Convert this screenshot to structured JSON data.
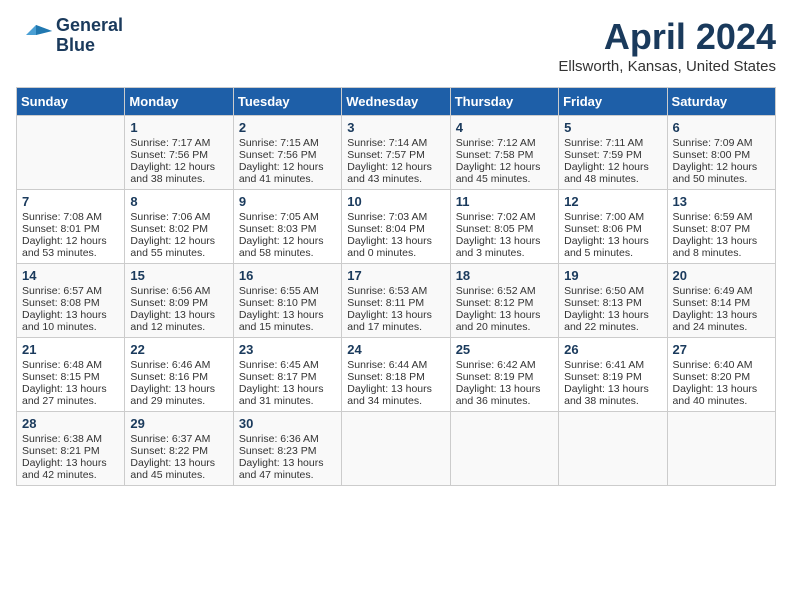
{
  "header": {
    "logo_line1": "General",
    "logo_line2": "Blue",
    "month": "April 2024",
    "location": "Ellsworth, Kansas, United States"
  },
  "weekdays": [
    "Sunday",
    "Monday",
    "Tuesday",
    "Wednesday",
    "Thursday",
    "Friday",
    "Saturday"
  ],
  "weeks": [
    [
      {
        "day": "",
        "sunrise": "",
        "sunset": "",
        "daylight": ""
      },
      {
        "day": "1",
        "sunrise": "Sunrise: 7:17 AM",
        "sunset": "Sunset: 7:56 PM",
        "daylight": "Daylight: 12 hours and 38 minutes."
      },
      {
        "day": "2",
        "sunrise": "Sunrise: 7:15 AM",
        "sunset": "Sunset: 7:56 PM",
        "daylight": "Daylight: 12 hours and 41 minutes."
      },
      {
        "day": "3",
        "sunrise": "Sunrise: 7:14 AM",
        "sunset": "Sunset: 7:57 PM",
        "daylight": "Daylight: 12 hours and 43 minutes."
      },
      {
        "day": "4",
        "sunrise": "Sunrise: 7:12 AM",
        "sunset": "Sunset: 7:58 PM",
        "daylight": "Daylight: 12 hours and 45 minutes."
      },
      {
        "day": "5",
        "sunrise": "Sunrise: 7:11 AM",
        "sunset": "Sunset: 7:59 PM",
        "daylight": "Daylight: 12 hours and 48 minutes."
      },
      {
        "day": "6",
        "sunrise": "Sunrise: 7:09 AM",
        "sunset": "Sunset: 8:00 PM",
        "daylight": "Daylight: 12 hours and 50 minutes."
      }
    ],
    [
      {
        "day": "7",
        "sunrise": "Sunrise: 7:08 AM",
        "sunset": "Sunset: 8:01 PM",
        "daylight": "Daylight: 12 hours and 53 minutes."
      },
      {
        "day": "8",
        "sunrise": "Sunrise: 7:06 AM",
        "sunset": "Sunset: 8:02 PM",
        "daylight": "Daylight: 12 hours and 55 minutes."
      },
      {
        "day": "9",
        "sunrise": "Sunrise: 7:05 AM",
        "sunset": "Sunset: 8:03 PM",
        "daylight": "Daylight: 12 hours and 58 minutes."
      },
      {
        "day": "10",
        "sunrise": "Sunrise: 7:03 AM",
        "sunset": "Sunset: 8:04 PM",
        "daylight": "Daylight: 13 hours and 0 minutes."
      },
      {
        "day": "11",
        "sunrise": "Sunrise: 7:02 AM",
        "sunset": "Sunset: 8:05 PM",
        "daylight": "Daylight: 13 hours and 3 minutes."
      },
      {
        "day": "12",
        "sunrise": "Sunrise: 7:00 AM",
        "sunset": "Sunset: 8:06 PM",
        "daylight": "Daylight: 13 hours and 5 minutes."
      },
      {
        "day": "13",
        "sunrise": "Sunrise: 6:59 AM",
        "sunset": "Sunset: 8:07 PM",
        "daylight": "Daylight: 13 hours and 8 minutes."
      }
    ],
    [
      {
        "day": "14",
        "sunrise": "Sunrise: 6:57 AM",
        "sunset": "Sunset: 8:08 PM",
        "daylight": "Daylight: 13 hours and 10 minutes."
      },
      {
        "day": "15",
        "sunrise": "Sunrise: 6:56 AM",
        "sunset": "Sunset: 8:09 PM",
        "daylight": "Daylight: 13 hours and 12 minutes."
      },
      {
        "day": "16",
        "sunrise": "Sunrise: 6:55 AM",
        "sunset": "Sunset: 8:10 PM",
        "daylight": "Daylight: 13 hours and 15 minutes."
      },
      {
        "day": "17",
        "sunrise": "Sunrise: 6:53 AM",
        "sunset": "Sunset: 8:11 PM",
        "daylight": "Daylight: 13 hours and 17 minutes."
      },
      {
        "day": "18",
        "sunrise": "Sunrise: 6:52 AM",
        "sunset": "Sunset: 8:12 PM",
        "daylight": "Daylight: 13 hours and 20 minutes."
      },
      {
        "day": "19",
        "sunrise": "Sunrise: 6:50 AM",
        "sunset": "Sunset: 8:13 PM",
        "daylight": "Daylight: 13 hours and 22 minutes."
      },
      {
        "day": "20",
        "sunrise": "Sunrise: 6:49 AM",
        "sunset": "Sunset: 8:14 PM",
        "daylight": "Daylight: 13 hours and 24 minutes."
      }
    ],
    [
      {
        "day": "21",
        "sunrise": "Sunrise: 6:48 AM",
        "sunset": "Sunset: 8:15 PM",
        "daylight": "Daylight: 13 hours and 27 minutes."
      },
      {
        "day": "22",
        "sunrise": "Sunrise: 6:46 AM",
        "sunset": "Sunset: 8:16 PM",
        "daylight": "Daylight: 13 hours and 29 minutes."
      },
      {
        "day": "23",
        "sunrise": "Sunrise: 6:45 AM",
        "sunset": "Sunset: 8:17 PM",
        "daylight": "Daylight: 13 hours and 31 minutes."
      },
      {
        "day": "24",
        "sunrise": "Sunrise: 6:44 AM",
        "sunset": "Sunset: 8:18 PM",
        "daylight": "Daylight: 13 hours and 34 minutes."
      },
      {
        "day": "25",
        "sunrise": "Sunrise: 6:42 AM",
        "sunset": "Sunset: 8:19 PM",
        "daylight": "Daylight: 13 hours and 36 minutes."
      },
      {
        "day": "26",
        "sunrise": "Sunrise: 6:41 AM",
        "sunset": "Sunset: 8:19 PM",
        "daylight": "Daylight: 13 hours and 38 minutes."
      },
      {
        "day": "27",
        "sunrise": "Sunrise: 6:40 AM",
        "sunset": "Sunset: 8:20 PM",
        "daylight": "Daylight: 13 hours and 40 minutes."
      }
    ],
    [
      {
        "day": "28",
        "sunrise": "Sunrise: 6:38 AM",
        "sunset": "Sunset: 8:21 PM",
        "daylight": "Daylight: 13 hours and 42 minutes."
      },
      {
        "day": "29",
        "sunrise": "Sunrise: 6:37 AM",
        "sunset": "Sunset: 8:22 PM",
        "daylight": "Daylight: 13 hours and 45 minutes."
      },
      {
        "day": "30",
        "sunrise": "Sunrise: 6:36 AM",
        "sunset": "Sunset: 8:23 PM",
        "daylight": "Daylight: 13 hours and 47 minutes."
      },
      {
        "day": "",
        "sunrise": "",
        "sunset": "",
        "daylight": ""
      },
      {
        "day": "",
        "sunrise": "",
        "sunset": "",
        "daylight": ""
      },
      {
        "day": "",
        "sunrise": "",
        "sunset": "",
        "daylight": ""
      },
      {
        "day": "",
        "sunrise": "",
        "sunset": "",
        "daylight": ""
      }
    ]
  ]
}
